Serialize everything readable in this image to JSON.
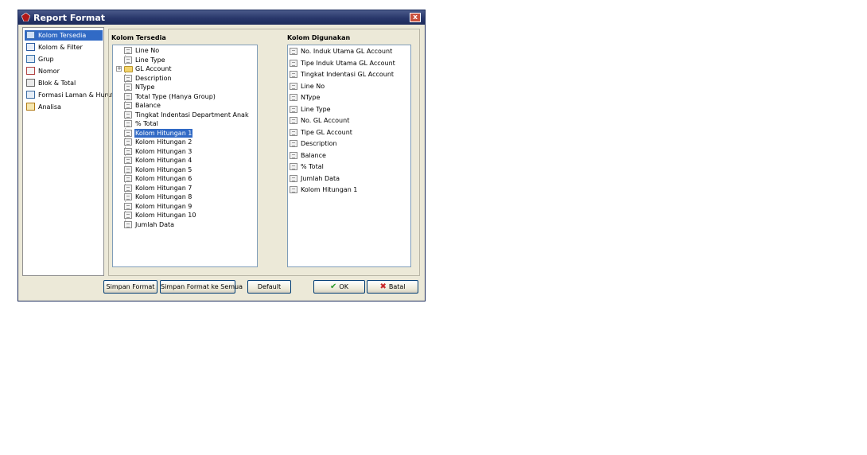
{
  "window": {
    "title": "Report Format",
    "close_label": "x"
  },
  "sidebar": {
    "items": [
      {
        "label": "Kolom Tersedia",
        "selected": true
      },
      {
        "label": "Kolom & Filter"
      },
      {
        "label": "Grup"
      },
      {
        "label": "Nomor"
      },
      {
        "label": "Blok & Total"
      },
      {
        "label": "Formasi Laman & Huruf"
      },
      {
        "label": "Analisa"
      }
    ]
  },
  "available": {
    "header": "Kolom Tersedia",
    "items": [
      {
        "label": "Line No"
      },
      {
        "label": "Line Type"
      },
      {
        "label": "GL Account",
        "folder": true
      },
      {
        "label": "Description"
      },
      {
        "label": "NType"
      },
      {
        "label": "Total Type (Hanya Group)"
      },
      {
        "label": "Balance"
      },
      {
        "label": "Tingkat Indentasi Department Anak"
      },
      {
        "label": "% Total"
      },
      {
        "label": "Kolom Hitungan 1",
        "selected": true
      },
      {
        "label": "Kolom Hitungan 2"
      },
      {
        "label": "Kolom Hitungan 3"
      },
      {
        "label": "Kolom Hitungan 4"
      },
      {
        "label": "Kolom Hitungan 5"
      },
      {
        "label": "Kolom Hitungan 6"
      },
      {
        "label": "Kolom Hitungan 7"
      },
      {
        "label": "Kolom Hitungan 8"
      },
      {
        "label": "Kolom Hitungan 9"
      },
      {
        "label": "Kolom Hitungan 10"
      },
      {
        "label": "Jumlah Data"
      }
    ]
  },
  "used": {
    "header": "Kolom Digunakan",
    "items": [
      "No. Induk Utama GL Account",
      "Tipe Induk Utama GL Account",
      "Tingkat Indentasi GL Account",
      "Line No",
      "NType",
      "Line Type",
      "No. GL Account",
      "Tipe GL Account",
      "Description",
      "Balance",
      "% Total",
      "Jumlah Data",
      "Kolom Hitungan 1"
    ]
  },
  "buttons": {
    "move": ">",
    "save_format": "Simpan Format",
    "save_all": "Simpan Format ke Semua",
    "default": "Default",
    "ok": "OK",
    "cancel": "Batal"
  },
  "colors": {
    "selection": "#316ac5",
    "title_bar": "#28376a"
  }
}
